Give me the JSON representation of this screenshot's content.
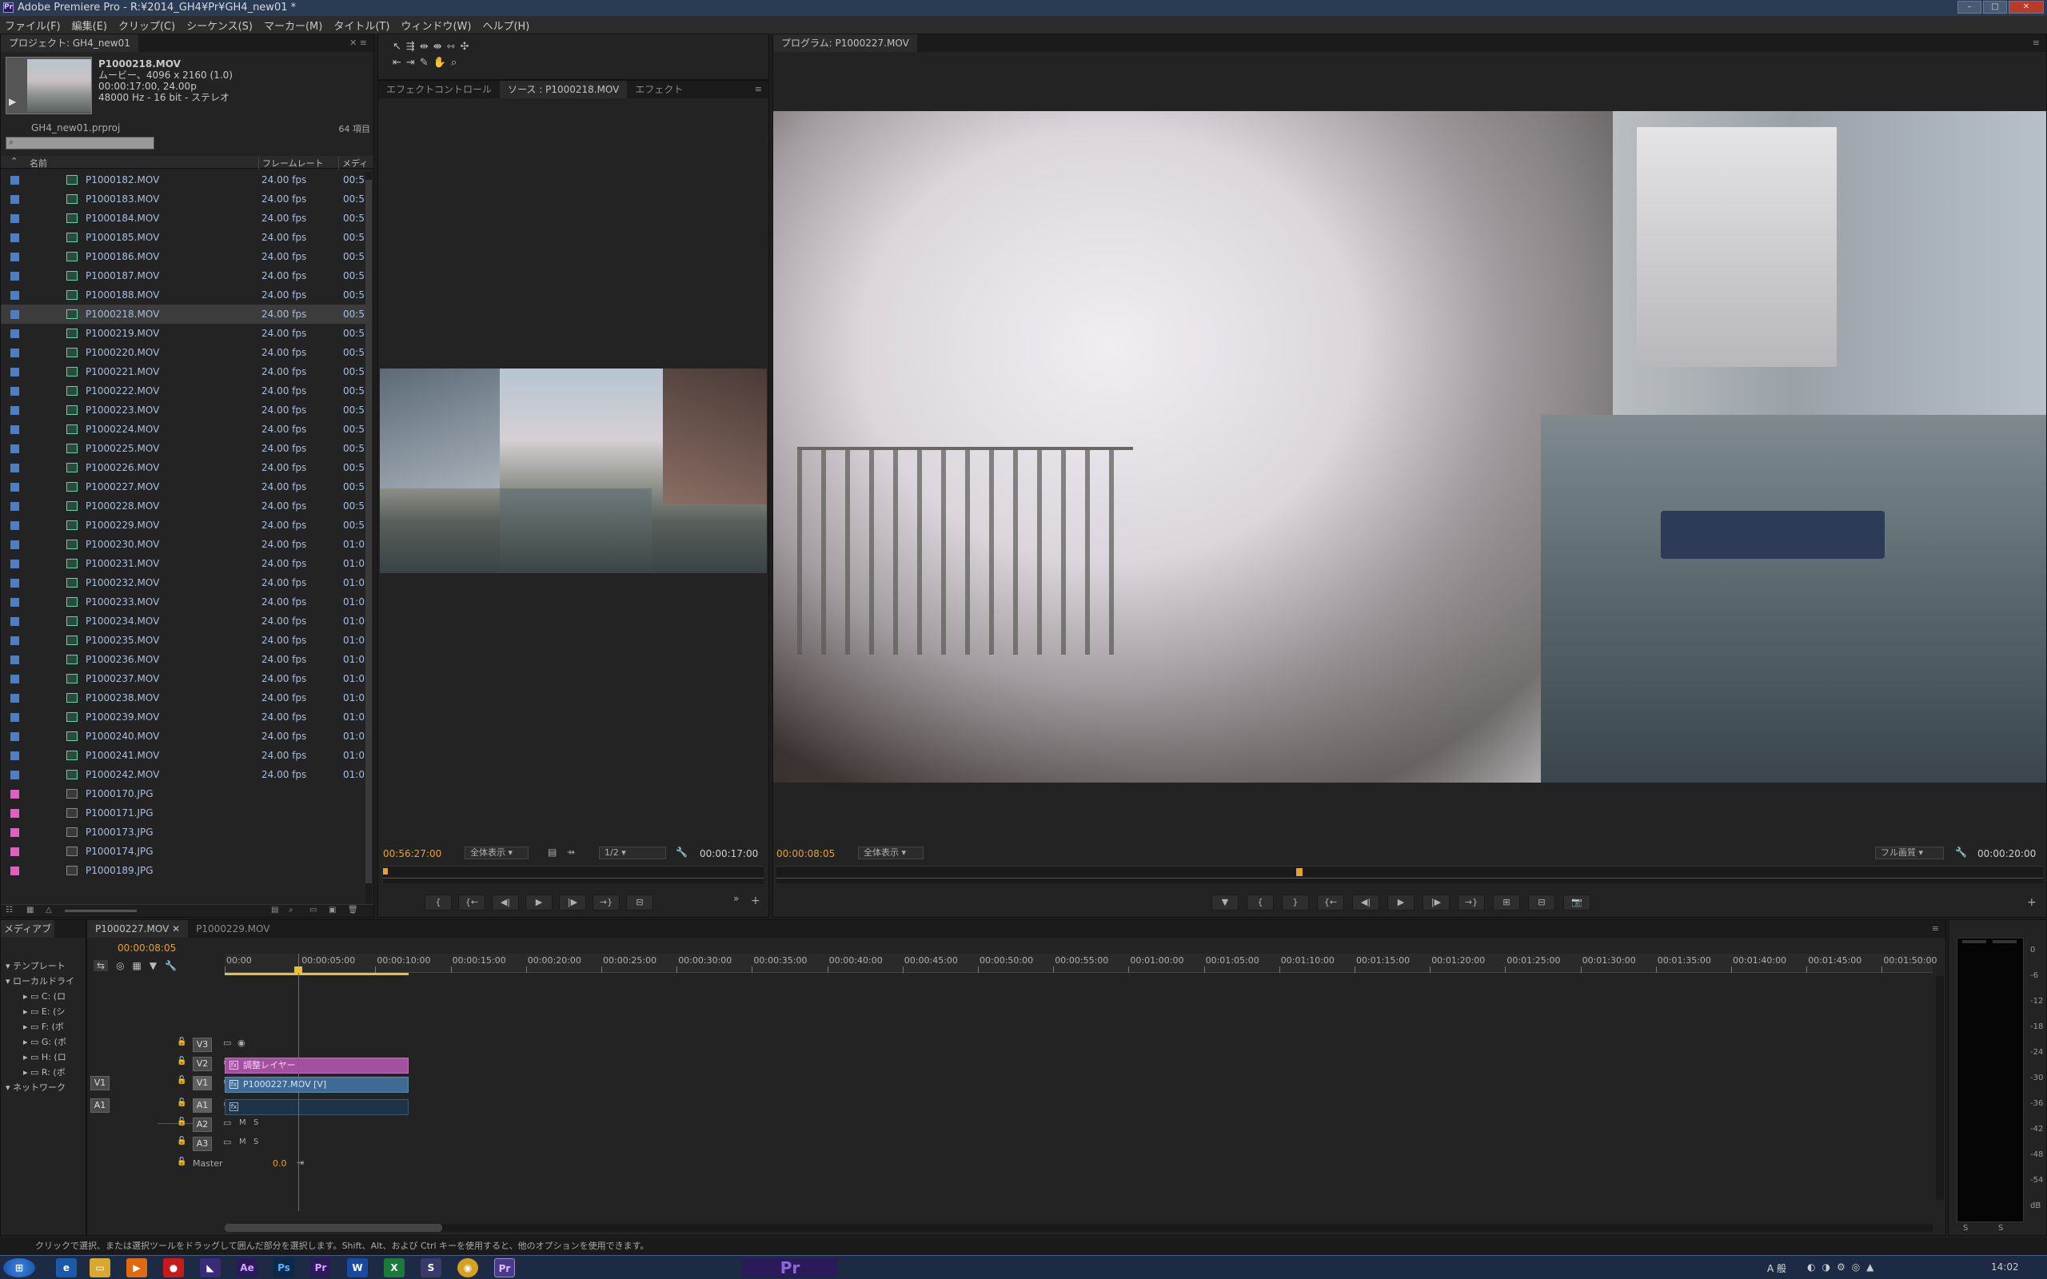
{
  "window": {
    "title": "Adobe Premiere Pro - R:¥2014_GH4¥Pr¥GH4_new01 *",
    "app_icon": "Pr"
  },
  "menu": [
    "ファイル(F)",
    "編集(E)",
    "クリップ(C)",
    "シーケンス(S)",
    "マーカー(M)",
    "タイトル(T)",
    "ウィンドウ(W)",
    "ヘルプ(H)"
  ],
  "project": {
    "tab": "プロジェクト: GH4_new01",
    "clip_name": "P1000218.MOV",
    "clip_info1": "ムービー、4096 x 2160 (1.0)",
    "clip_info2": "00:00:17:00, 24.00p",
    "clip_info3": "48000 Hz - 16 bit - ステレオ",
    "project_file": "GH4_new01.prproj",
    "item_count": "64 項目",
    "search_placeholder": "",
    "col_name": "名前",
    "col_fps": "フレームレート",
    "col_media": "メディ",
    "items": [
      {
        "name": "P1000182.MOV",
        "fps": "24.00 fps",
        "media": "00:5"
      },
      {
        "name": "P1000183.MOV",
        "fps": "24.00 fps",
        "media": "00:5"
      },
      {
        "name": "P1000184.MOV",
        "fps": "24.00 fps",
        "media": "00:5"
      },
      {
        "name": "P1000185.MOV",
        "fps": "24.00 fps",
        "media": "00:5"
      },
      {
        "name": "P1000186.MOV",
        "fps": "24.00 fps",
        "media": "00:5"
      },
      {
        "name": "P1000187.MOV",
        "fps": "24.00 fps",
        "media": "00:5"
      },
      {
        "name": "P1000188.MOV",
        "fps": "24.00 fps",
        "media": "00:5"
      },
      {
        "name": "P1000218.MOV",
        "fps": "24.00 fps",
        "media": "00:5"
      },
      {
        "name": "P1000219.MOV",
        "fps": "24.00 fps",
        "media": "00:5"
      },
      {
        "name": "P1000220.MOV",
        "fps": "24.00 fps",
        "media": "00:5"
      },
      {
        "name": "P1000221.MOV",
        "fps": "24.00 fps",
        "media": "00:5"
      },
      {
        "name": "P1000222.MOV",
        "fps": "24.00 fps",
        "media": "00:5"
      },
      {
        "name": "P1000223.MOV",
        "fps": "24.00 fps",
        "media": "00:5"
      },
      {
        "name": "P1000224.MOV",
        "fps": "24.00 fps",
        "media": "00:5"
      },
      {
        "name": "P1000225.MOV",
        "fps": "24.00 fps",
        "media": "00:5"
      },
      {
        "name": "P1000226.MOV",
        "fps": "24.00 fps",
        "media": "00:5"
      },
      {
        "name": "P1000227.MOV",
        "fps": "24.00 fps",
        "media": "00:5"
      },
      {
        "name": "P1000228.MOV",
        "fps": "24.00 fps",
        "media": "00:5"
      },
      {
        "name": "P1000229.MOV",
        "fps": "24.00 fps",
        "media": "00:5"
      },
      {
        "name": "P1000230.MOV",
        "fps": "24.00 fps",
        "media": "01:0"
      },
      {
        "name": "P1000231.MOV",
        "fps": "24.00 fps",
        "media": "01:0"
      },
      {
        "name": "P1000232.MOV",
        "fps": "24.00 fps",
        "media": "01:0"
      },
      {
        "name": "P1000233.MOV",
        "fps": "24.00 fps",
        "media": "01:0"
      },
      {
        "name": "P1000234.MOV",
        "fps": "24.00 fps",
        "media": "01:0"
      },
      {
        "name": "P1000235.MOV",
        "fps": "24.00 fps",
        "media": "01:0"
      },
      {
        "name": "P1000236.MOV",
        "fps": "24.00 fps",
        "media": "01:0"
      },
      {
        "name": "P1000237.MOV",
        "fps": "24.00 fps",
        "media": "01:0"
      },
      {
        "name": "P1000238.MOV",
        "fps": "24.00 fps",
        "media": "01:0"
      },
      {
        "name": "P1000239.MOV",
        "fps": "24.00 fps",
        "media": "01:0"
      },
      {
        "name": "P1000240.MOV",
        "fps": "24.00 fps",
        "media": "01:0"
      },
      {
        "name": "P1000241.MOV",
        "fps": "24.00 fps",
        "media": "01:0"
      },
      {
        "name": "P1000242.MOV",
        "fps": "24.00 fps",
        "media": "01:0"
      },
      {
        "name": "P1000170.JPG",
        "fps": "",
        "media": ""
      },
      {
        "name": "P1000171.JPG",
        "fps": "",
        "media": ""
      },
      {
        "name": "P1000173.JPG",
        "fps": "",
        "media": ""
      },
      {
        "name": "P1000174.JPG",
        "fps": "",
        "media": ""
      },
      {
        "name": "P1000189.JPG",
        "fps": "",
        "media": ""
      }
    ]
  },
  "source": {
    "tabs": [
      "エフェクトコントロール",
      "ソース : P1000218.MOV",
      "エフェクト"
    ],
    "timecode_left": "00:56:27:00",
    "zoom": "全体表示",
    "resolution": "1/2",
    "timecode_right": "00:00:17:00"
  },
  "program": {
    "tab": "プログラム: P1000227.MOV",
    "timecode_left": "00:00:08:05",
    "zoom": "全体表示",
    "quality": "フル画質",
    "timecode_right": "00:00:20:00"
  },
  "media_browser": {
    "tab": "メディアブ",
    "items": [
      "テンプレート",
      "ローカルドライ",
      "C: (ロ",
      "E: (シ",
      "F: (ボ",
      "G: (ボ",
      "H: (ロ",
      "R: (ボ",
      "ネットワーク"
    ]
  },
  "timeline": {
    "tabs": [
      "P1000227.MOV",
      "P1000229.MOV"
    ],
    "timecode": "00:00:08:05",
    "ruler": [
      "00:00",
      "00:00:05:00",
      "00:00:10:00",
      "00:00:15:00",
      "00:00:20:00",
      "00:00:25:00",
      "00:00:30:00",
      "00:00:35:00",
      "00:00:40:00",
      "00:00:45:00",
      "00:00:50:00",
      "00:00:55:00",
      "00:01:00:00",
      "00:01:05:00",
      "00:01:10:00",
      "00:01:15:00",
      "00:01:20:00",
      "00:01:25:00",
      "00:01:30:00",
      "00:01:35:00",
      "00:01:40:00",
      "00:01:45:00",
      "00:01:50:00"
    ],
    "video_tracks": [
      "V3",
      "V2",
      "V1"
    ],
    "audio_tracks": [
      "A1",
      "A2",
      "A3"
    ],
    "source_v": "V1",
    "source_a": "A1",
    "master_label": "Master",
    "master_value": "0.0",
    "m_label": "M",
    "s_label": "S",
    "clip_adjust": "調整レイヤー",
    "clip_video": "P1000227.MOV [V]"
  },
  "meters": {
    "labels": [
      "0",
      "-6",
      "-12",
      "-18",
      "-24",
      "-30",
      "-36",
      "-42",
      "-48",
      "-54",
      "dB"
    ],
    "s_label": "S"
  },
  "status": "クリックで選択、または選択ツールをドラッグして囲んだ部分を選択します。Shift、Alt、および Ctrl キーを使用すると、他のオプションを使用できます。",
  "taskbar": {
    "clock": "14:02",
    "ime": "A 般"
  }
}
